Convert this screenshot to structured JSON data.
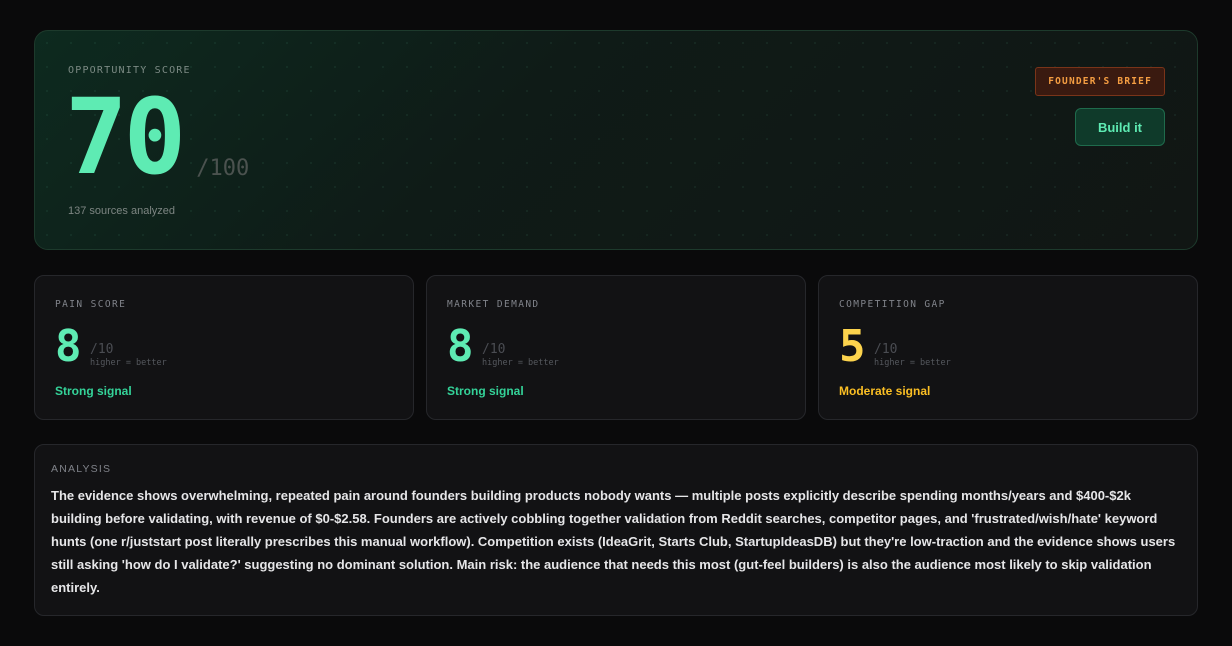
{
  "hero": {
    "label": "OPPORTUNITY SCORE",
    "score": "70",
    "max": "/100",
    "sources": "137 sources analyzed",
    "badge": "FOUNDER'S BRIEF",
    "action": "Build it"
  },
  "metrics": [
    {
      "label": "PAIN SCORE",
      "value": "8",
      "max": "/10",
      "hint": "higher = better",
      "signal": "Strong signal"
    },
    {
      "label": "MARKET DEMAND",
      "value": "8",
      "max": "/10",
      "hint": "higher = better",
      "signal": "Strong signal"
    },
    {
      "label": "COMPETITION GAP",
      "value": "5",
      "max": "/10",
      "hint": "higher = better",
      "signal": "Moderate signal"
    }
  ],
  "analysis": {
    "label": "ANALYSIS",
    "text": "The evidence shows overwhelming, repeated pain around founders building products nobody wants — multiple posts explicitly describe spending months/years and $400-$2k building before validating, with revenue of $0-$2.58. Founders are actively cobbling together validation from Reddit searches, competitor pages, and 'frustrated/wish/hate' keyword hunts (one r/juststart post literally prescribes this manual workflow). Competition exists (IdeaGrit, Starts Club, StartupIdeasDB) but they're low-traction and the evidence shows users still asking 'how do I validate?' suggesting no dominant solution. Main risk: the audience that needs this most (gut-feel builders) is also the audience most likely to skip validation entirely."
  },
  "colors": {
    "accent_green": "#5eebb3",
    "accent_yellow": "#fcd34d",
    "badge_orange": "#f59e42"
  }
}
